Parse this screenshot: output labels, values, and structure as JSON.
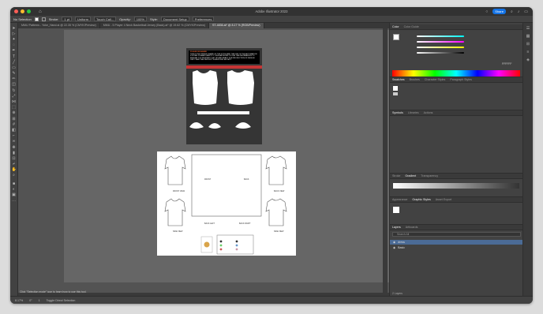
{
  "app_title": "Adobe Illustrator 2023",
  "share_label": "Share",
  "controls": {
    "selection": "No Selection",
    "stroke_label": "Stroke:",
    "stroke_value": "1 pt",
    "stroke_style": "Uniform",
    "brush": "Touch Call...",
    "opacity_label": "Opacity:",
    "opacity_value": "100%",
    "style_label": "Style:",
    "doc_setup": "Document Setup",
    "preferences": "Preferences"
  },
  "tabs": [
    "MMU Patterns - Yoke_Hand.ai @ 22.35 % (CMYK/Preview)",
    "MMU - 5 Player 4 Neck Basketball Jersey (Back).ai* @ 19.62 % (CMYK/Preview)",
    "ST-4836.ai* @ 8.17 % (RGB/Preview)"
  ],
  "artboard1": {
    "title": "PLEASE BE AWARE",
    "text": "THIS IS THE UNIQUE SHAPE OF THE STYLE AND THE USE OF THE AUTOMATION SYSTEM. PLEASE DIRECTLY YOUR ARTWORK TO USE THE INFORMATION TO ENSURE IT IS PROPERLY SET UP AND READY FOR PRODUCTION OF DESIGN ONLY THAT THE PRODUCT WORKS WILL ACCEPT."
  },
  "artboard2": {
    "labels": [
      "FRONT VIEW",
      "BACK VIEW",
      "FRONT",
      "BACK",
      "SIDE VIEW",
      "SIDE VIEW",
      "BACK LEFT",
      "BACK RIGHT"
    ]
  },
  "panels": {
    "color_tabs": [
      "Color",
      "Color Guide"
    ],
    "color_hex": "FFFFFF",
    "swatches_tabs": [
      "Swatches",
      "Brushes",
      "Character Styles",
      "Paragraph Styles"
    ],
    "symbols_tabs": [
      "Symbols",
      "Libraries",
      "Actions"
    ],
    "stroke_tabs": [
      "Stroke",
      "Gradient",
      "Transparency"
    ],
    "appearance_tabs": [
      "Appearance",
      "Graphic Styles",
      "Asset Export"
    ],
    "layers_tabs": [
      "Layers",
      "Artboards"
    ],
    "layers_search": "Search All",
    "layers": [
      "dress",
      "Basic"
    ]
  },
  "status": {
    "zoom": "8.17%",
    "rotation": "0°",
    "artboard": "1",
    "mode": "Toggle Direct Selection",
    "tip": "Click \"Selection mode\" icon to learn how to use this tool."
  },
  "layers_count": "2 Layers"
}
